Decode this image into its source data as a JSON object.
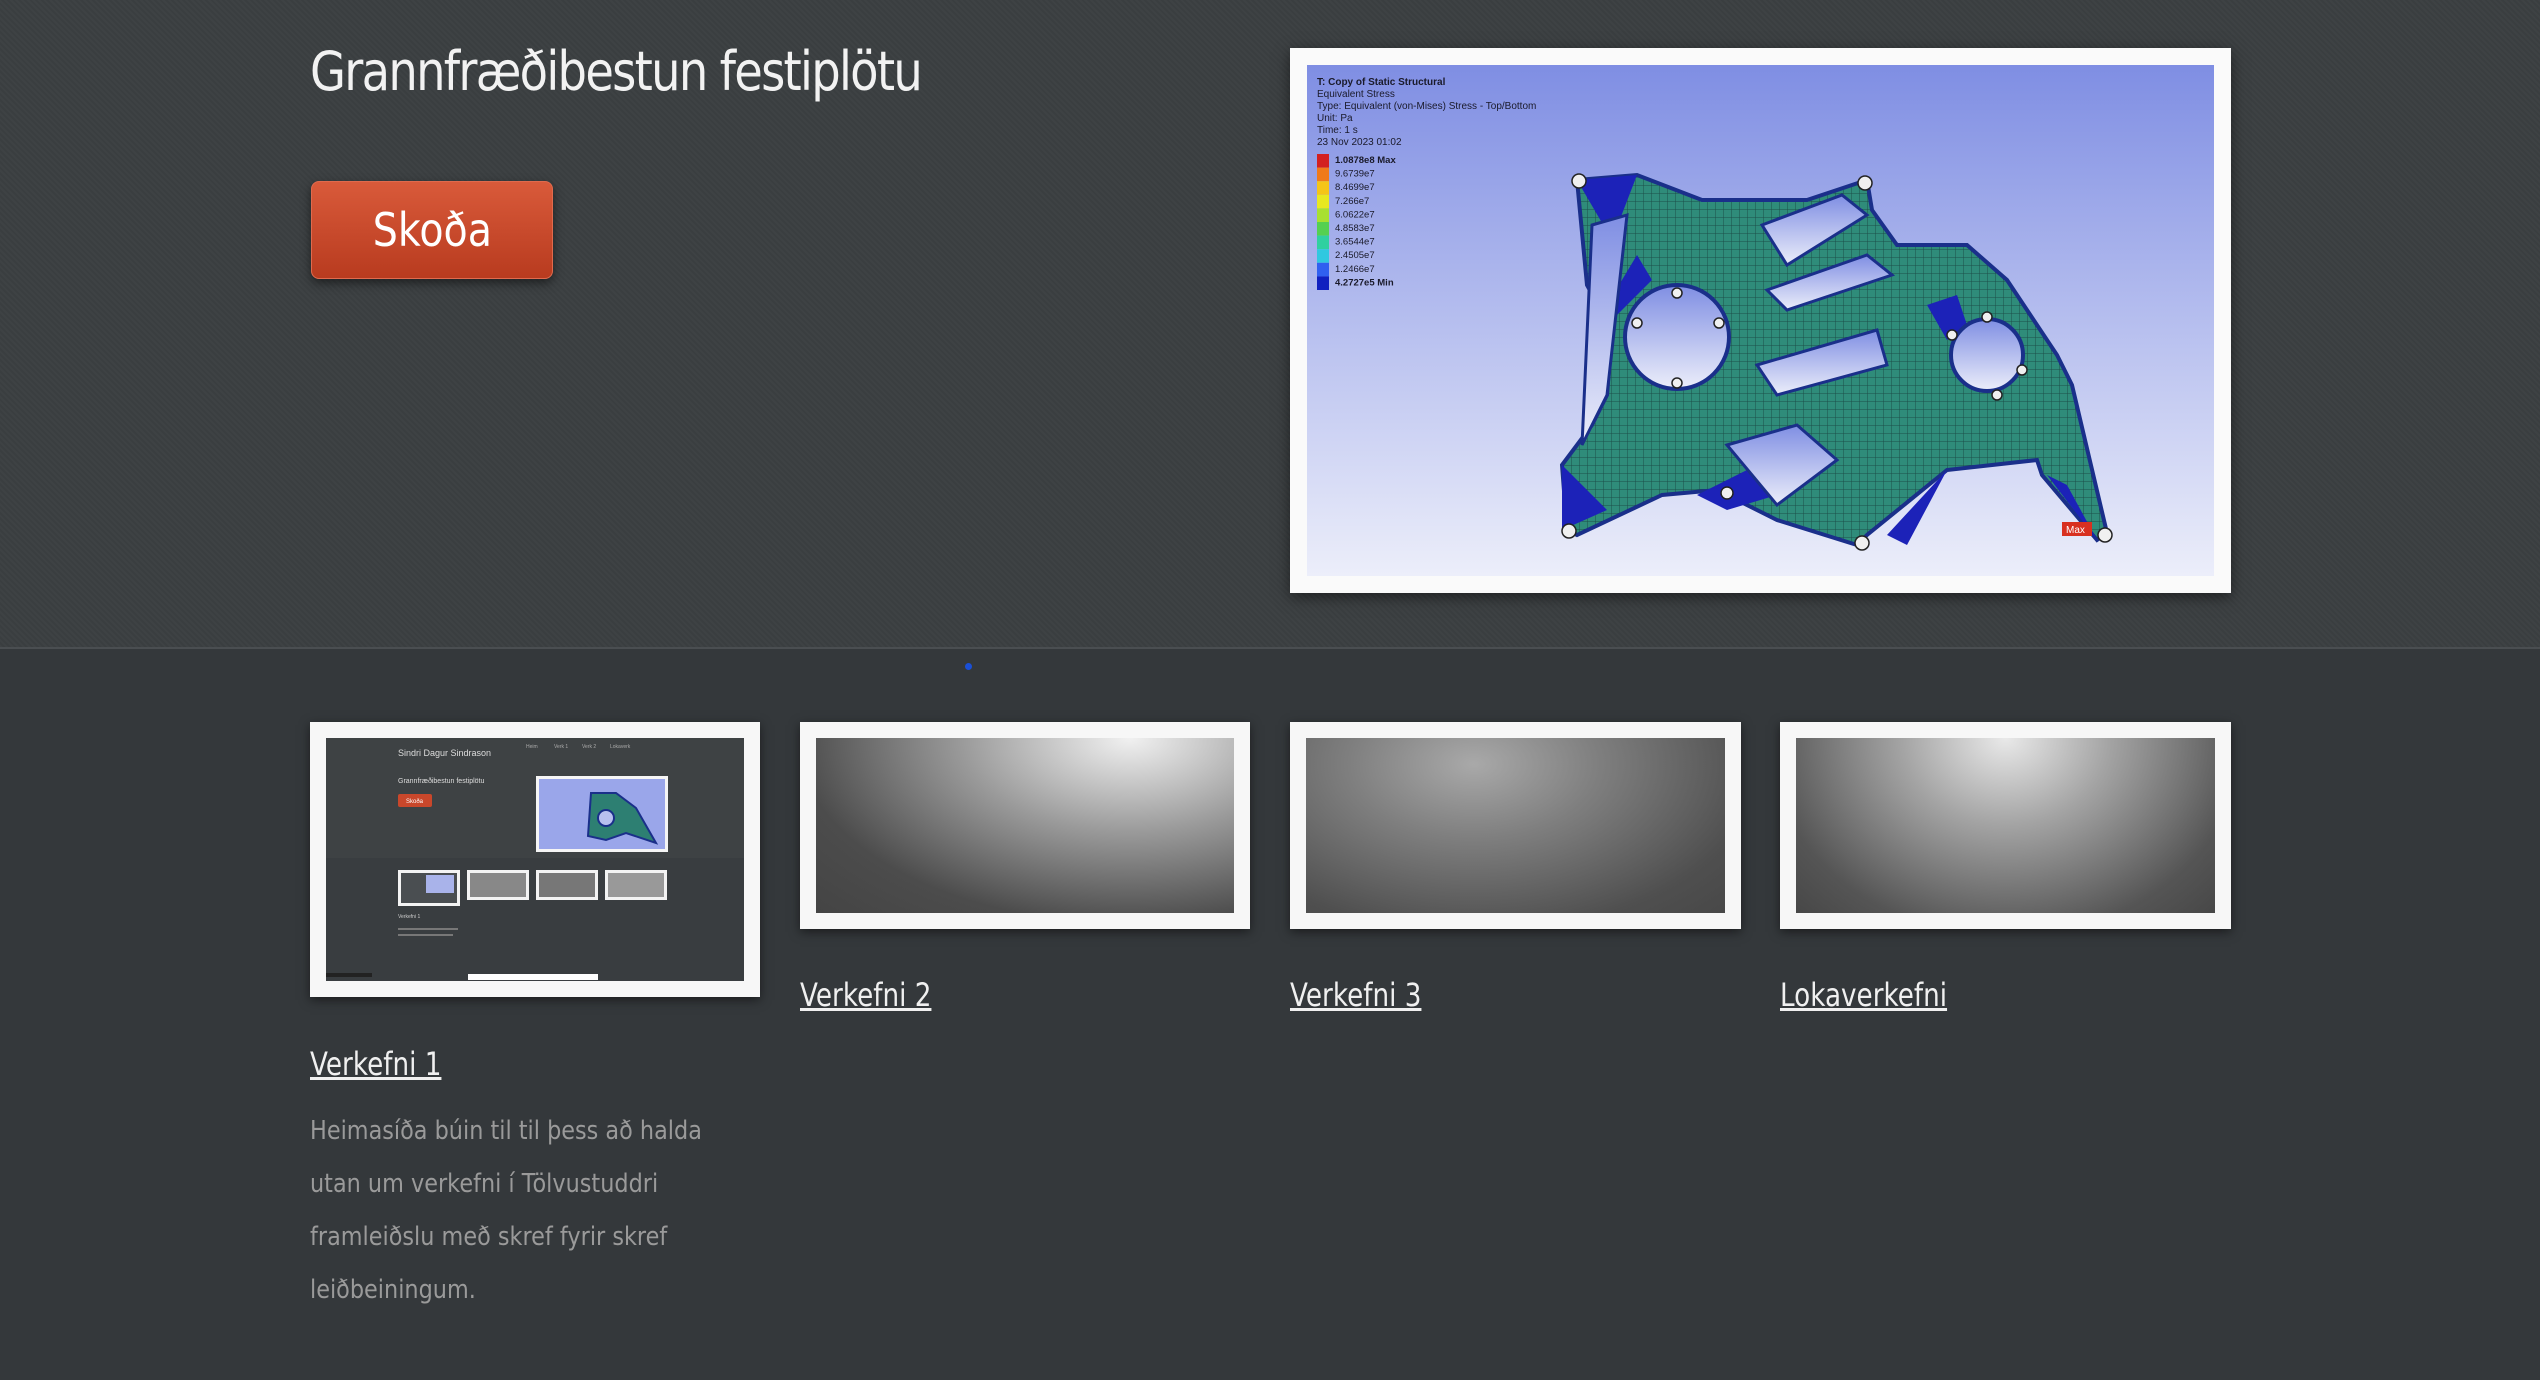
{
  "hero": {
    "title": "Grannfræðibestun festiplötu",
    "button_label": "Skoða",
    "figure": {
      "header": [
        "T: Copy of Static Structural",
        "Equivalent Stress",
        "Type: Equivalent (von-Mises) Stress - Top/Bottom",
        "Unit: Pa",
        "Time: 1 s",
        "23 Nov 2023 01:02"
      ],
      "legend": [
        "1.0878e8 Max",
        "9.6739e7",
        "8.4699e7",
        "7.266e7",
        "6.0622e7",
        "4.8583e7",
        "3.6544e7",
        "2.4505e7",
        "1.2466e7",
        "4.2727e5 Min"
      ],
      "legend_colors": [
        "#d32020",
        "#f07a1a",
        "#f5c518",
        "#e8e820",
        "#a8e030",
        "#55d050",
        "#30d0a0",
        "#30c8e0",
        "#3060f0",
        "#1020c0"
      ],
      "max_tag": "Max"
    }
  },
  "projects": [
    {
      "title": "Verkefni 1",
      "description": "Heimasíða búin til til þess að halda utan um verkefni í Tölvustuddri framleiðslu með skref fyrir skref leiðbeiningum."
    },
    {
      "title": "Verkefni 2"
    },
    {
      "title": "Verkefni 3"
    },
    {
      "title": "Lokaverkefni"
    }
  ],
  "thumb1": {
    "site_name": "Sindri Dagur Sindrason",
    "nav": [
      "Heim",
      "Verk 1",
      "Verk 2",
      "Lokaverk"
    ],
    "hero_title": "Grannfræðibestun festiplötu",
    "button": "Skoða",
    "card_title": "Verkefni 1"
  },
  "colors": {
    "page_bg": "#34383b",
    "hero_bg": "#3c4042",
    "button": "#c9472b",
    "accent_dot": "#1a4fd6",
    "figure_bg": "#8a98e6"
  }
}
